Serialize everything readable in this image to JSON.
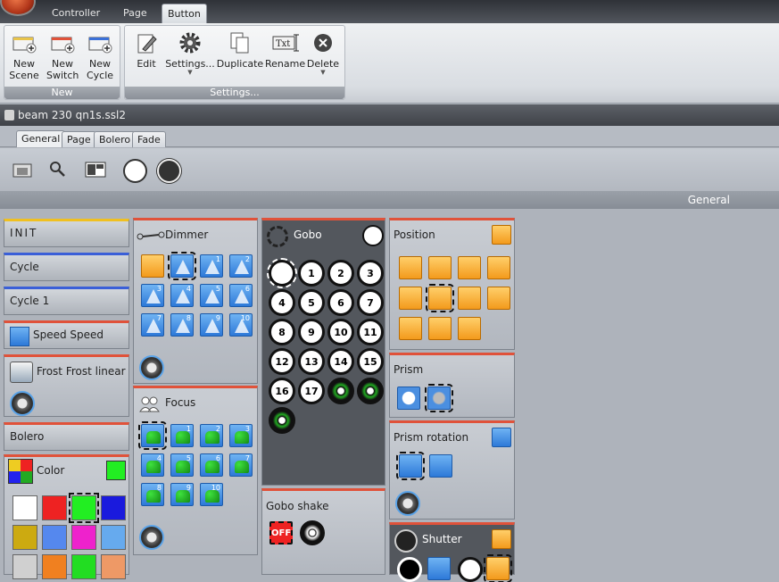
{
  "ribbon": {
    "tabs": [
      "Controller",
      "Page",
      "Button"
    ],
    "groups": {
      "new": {
        "caption": "New",
        "buttons": [
          {
            "label": "New\nScene",
            "line1": "New",
            "line2": "Scene"
          },
          {
            "label": "New\nSwitch",
            "line1": "New",
            "line2": "Switch"
          },
          {
            "label": "New\nCycle",
            "line1": "New",
            "line2": "Cycle"
          }
        ]
      },
      "settings": {
        "caption": "Settings...",
        "buttons": [
          {
            "label": "Edit"
          },
          {
            "label": "Settings..."
          },
          {
            "label": "Duplicate"
          },
          {
            "label": "Rename"
          },
          {
            "label": "Delete"
          }
        ]
      }
    }
  },
  "document": {
    "title": "beam 230 qn1s.ssl2"
  },
  "tabs": [
    "General",
    "Page",
    "Bolero",
    "Fade"
  ],
  "section": {
    "label": "General"
  },
  "cues": [
    {
      "label": "INIT",
      "color": "#f0c020"
    },
    {
      "label": "Cycle",
      "color": "#3a5fd8"
    },
    {
      "label": "Cycle 1",
      "color": "#3a5fd8"
    },
    {
      "label": "Speed Speed",
      "color": "#e0523a"
    },
    {
      "label": "Frost Frost linear",
      "color": "#e0523a"
    },
    {
      "label": "Bolero",
      "color": "#e0523a"
    }
  ],
  "panels": {
    "dimmer": {
      "title": "Dimmer",
      "numbers": [
        "1",
        "2",
        "3",
        "4",
        "5",
        "6",
        "7",
        "8",
        "9",
        "10"
      ]
    },
    "focus": {
      "title": "Focus",
      "numbers": [
        "1",
        "2",
        "3",
        "4",
        "5",
        "6",
        "7",
        "8",
        "9",
        "10"
      ]
    },
    "color": {
      "title": "Color",
      "swatches": [
        "#ffffff",
        "#ee2222",
        "#22ee22",
        "#1a1add",
        "#ccaa11",
        "#5588ee",
        "#ee22cc",
        "#66aaee",
        "#d0d0d0",
        "#f08020",
        "#22dd22",
        "#ee9966"
      ]
    },
    "gobo": {
      "title": "Gobo",
      "numbers": [
        "1",
        "2",
        "3",
        "4",
        "5",
        "6",
        "7",
        "8",
        "9",
        "10",
        "11",
        "12",
        "13",
        "14",
        "15",
        "16",
        "17"
      ]
    },
    "gobo_shake": {
      "title": "Gobo shake",
      "off_label": "OFF"
    },
    "position": {
      "title": "Position"
    },
    "prism": {
      "title": "Prism"
    },
    "prism_rotation": {
      "title": "Prism rotation"
    },
    "shutter": {
      "title": "Shutter"
    }
  }
}
